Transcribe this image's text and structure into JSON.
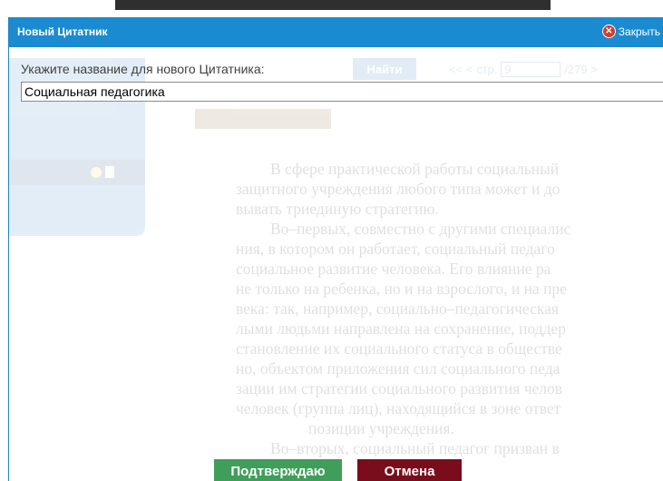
{
  "dialog": {
    "title": "Новый Цитатник",
    "close_label": "Закрыть",
    "prompt": "Укажите название для нового Цитатника:",
    "input_value": "Социальная педагогика",
    "confirm_label": "Подтверждаю",
    "cancel_label": "Отмена"
  },
  "background": {
    "find_label": "Найти",
    "pager_prefix": "<< < стр.",
    "page_value": "9",
    "pager_suffix": "/279 >",
    "text_lines": [
      "В сфере практической работы социальный",
      "защитного учреждения любого типа может и до",
      "вывать триединую стратегию.",
      "Во–первых, совместно с другими специалис",
      "ния, в котором он работает, социальный педаго",
      "социальное развитие человека. Его влияние ра",
      "не только на ребенка, но и на взрослого, и на пре",
      "века: так, например, социально–педагогическая",
      "лыми людьми направлена на сохранение, поддер",
      "становление их социального статуса в обществе",
      "но, объектом приложения сил социального педа",
      "зации им стратегии социального развития челов",
      "человек (группа лиц), находящийся в зоне ответ",
      "позиции учреждения.",
      "Во–вторых, социальный педагог призван в"
    ]
  },
  "colors": {
    "title_bar": "#1a8bd1",
    "confirm": "#3e9e5a",
    "cancel": "#7a0d1c",
    "close_icon": "#d63a2c"
  }
}
